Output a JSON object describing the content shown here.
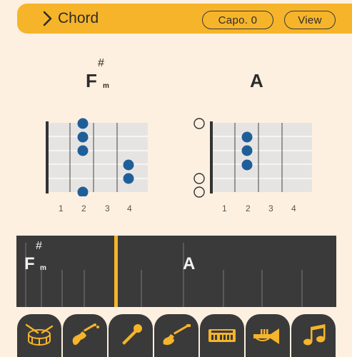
{
  "header": {
    "title": "Chord",
    "capo_label": "Capo. 0",
    "view_label": "View"
  },
  "chords": [
    {
      "root": "F",
      "accidental": "#",
      "quality": "m",
      "open_strings": [],
      "fingers": [
        [
          1,
          2
        ],
        [
          2,
          2
        ],
        [
          3,
          2
        ],
        [
          4,
          4
        ],
        [
          5,
          4
        ],
        [
          6,
          2
        ]
      ]
    },
    {
      "root": "A",
      "accidental": "",
      "quality": "",
      "open_strings": [
        1,
        5,
        6
      ],
      "fingers": [
        [
          2,
          2
        ],
        [
          3,
          2
        ],
        [
          4,
          2
        ]
      ]
    }
  ],
  "fret_numbers": [
    "1",
    "2",
    "3",
    "4"
  ],
  "timeline": {
    "chord1_root": "F",
    "chord1_accidental": "#",
    "chord1_quality": "m",
    "chord2_root": "A"
  },
  "instrument_tabs": [
    {
      "icon": "drum-icon"
    },
    {
      "icon": "bass-guitar-icon"
    },
    {
      "icon": "microphone-icon"
    },
    {
      "icon": "electric-guitar-icon"
    },
    {
      "icon": "keyboard-icon"
    },
    {
      "icon": "trumpet-icon"
    },
    {
      "icon": "music-note-icon"
    }
  ],
  "colors": {
    "background": "#fdf0e0",
    "accent": "#f6b42a",
    "dark": "#3a3a3a",
    "finger_dot": "#1f5f99",
    "fretboard": "#e6e4e2"
  }
}
